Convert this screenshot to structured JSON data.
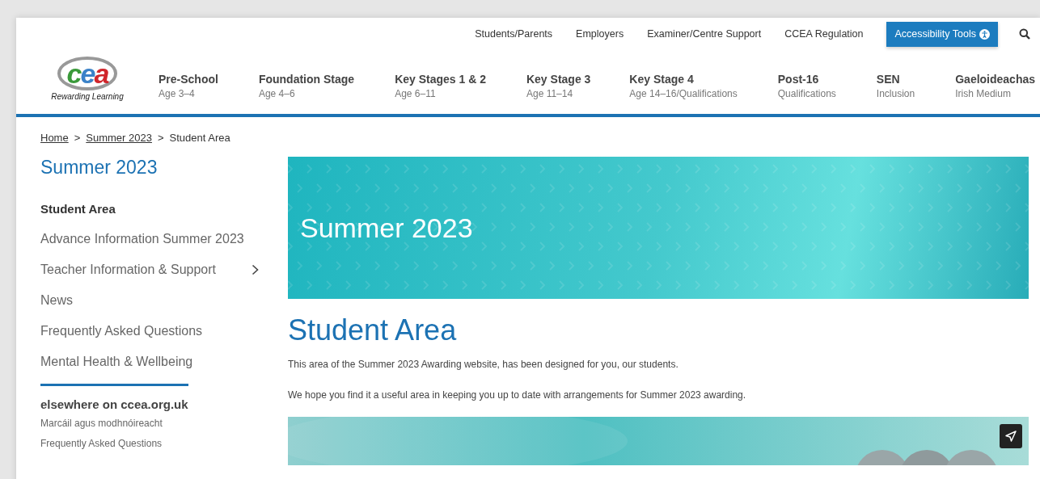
{
  "top_links": [
    {
      "label": "Students/Parents"
    },
    {
      "label": "Employers"
    },
    {
      "label": "Examiner/Centre Support"
    },
    {
      "label": "CCEA Regulation"
    }
  ],
  "accessibility_button": {
    "label": "Accessibility Tools"
  },
  "logo": {
    "mark": "cea",
    "tagline": "Rewarding Learning"
  },
  "main_nav": [
    {
      "title": "Pre-School",
      "subtitle": "Age 3–4"
    },
    {
      "title": "Foundation Stage",
      "subtitle": "Age 4–6"
    },
    {
      "title": "Key Stages 1 & 2",
      "subtitle": "Age 6–11"
    },
    {
      "title": "Key Stage 3",
      "subtitle": "Age 11–14"
    },
    {
      "title": "Key Stage 4",
      "subtitle": "Age 14–16/Qualifications"
    },
    {
      "title": "Post-16",
      "subtitle": "Qualifications"
    },
    {
      "title": "SEN",
      "subtitle": "Inclusion"
    },
    {
      "title": "Gaeloideachas",
      "subtitle": "Irish Medium"
    }
  ],
  "breadcrumb_separator": ">",
  "breadcrumb": [
    {
      "label": "Home",
      "link": true
    },
    {
      "label": "Summer 2023",
      "link": true
    },
    {
      "label": "Student Area",
      "link": false
    }
  ],
  "sidebar": {
    "title": "Summer 2023",
    "items": [
      {
        "label": "Student Area",
        "selected": true,
        "has_children": false
      },
      {
        "label": "Advance Information Summer 2023",
        "selected": false,
        "has_children": false
      },
      {
        "label": "Teacher Information & Support",
        "selected": false,
        "has_children": true
      },
      {
        "label": "News",
        "selected": false,
        "has_children": false
      },
      {
        "label": "Frequently Asked Questions",
        "selected": false,
        "has_children": false
      },
      {
        "label": "Mental Health & Wellbeing",
        "selected": false,
        "has_children": false
      }
    ],
    "elsewhere": {
      "heading": "elsewhere on ccea.org.uk",
      "links": [
        "Marcáil agus modhnóireacht",
        "Frequently Asked Questions"
      ]
    }
  },
  "hero": {
    "title": "Summer 2023"
  },
  "content": {
    "heading": "Student Area",
    "paragraphs": [
      "This area of the Summer 2023 Awarding website, has been designed for you, our students.",
      "We hope you find it a useful area in keeping you up to date with arrangements for Summer 2023 awarding."
    ],
    "media": {
      "kind": "picture"
    }
  }
}
